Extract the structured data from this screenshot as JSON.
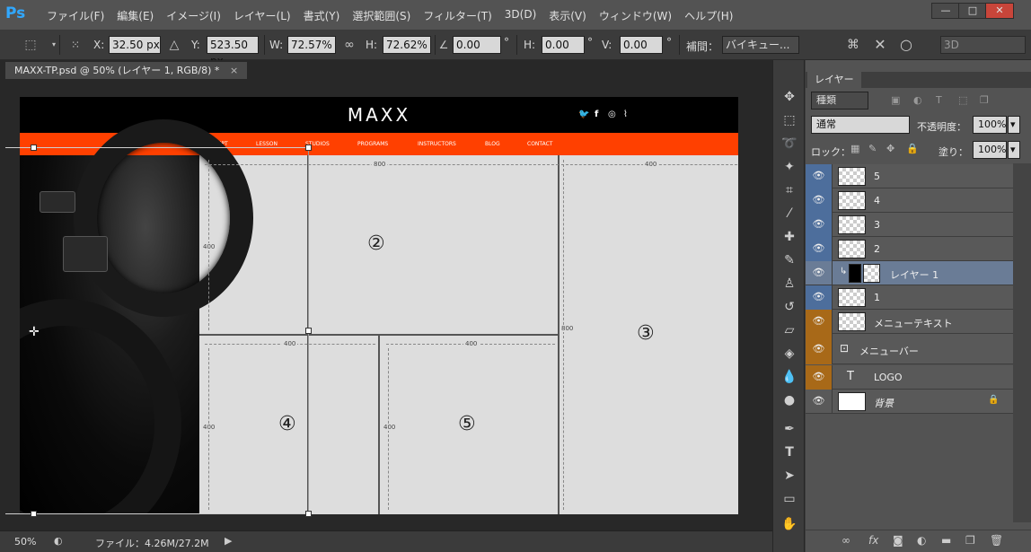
{
  "app": {
    "logo": "Ps",
    "menu": [
      "ファイル(F)",
      "編集(E)",
      "イメージ(I)",
      "レイヤー(L)",
      "書式(Y)",
      "選択範囲(S)",
      "フィルター(T)",
      "3D(D)",
      "表示(V)",
      "ウィンドウ(W)",
      "ヘルプ(H)"
    ],
    "window_buttons": [
      "—",
      "□",
      "✕"
    ]
  },
  "options": {
    "x_label": "X:",
    "x_value": "32.50 px",
    "y_label": "Y:",
    "y_value": "523.50 px",
    "w_label": "W:",
    "w_value": "72.57%",
    "h_label": "H:",
    "h_value": "72.62%",
    "angle_value": "0.00",
    "angle_unit": "°",
    "hskew_label": "H:",
    "hskew_value": "0.00",
    "hskew_unit": "°",
    "vskew_label": "V:",
    "vskew_value": "0.00",
    "vskew_unit": "°",
    "interp_label": "補間：",
    "interp_value": "バイキュー...",
    "mode_3d": "3D"
  },
  "document": {
    "tab_title": "MAXX-TP.psd @ 50% (レイヤー 1, RGB/8) *",
    "close": "×"
  },
  "mockup": {
    "logo": "MAXX",
    "social_icons": [
      "twitter-icon",
      "facebook-icon",
      "instagram-icon",
      "rss-icon"
    ],
    "nav": [
      "CONCEPT",
      "LESSON",
      "STUDIOS",
      "PROGRAMS",
      "INSTRUCTORS",
      "BLOG",
      "CONTACT"
    ],
    "dims": {
      "top_800": "800",
      "top_400": "400",
      "left_400": "400",
      "mid_800": "800",
      "row2_400a": "400",
      "row2_400b": "400",
      "left2_400": "400",
      "mid2_400": "400"
    },
    "cells": [
      "②",
      "③",
      "④",
      "⑤"
    ]
  },
  "status": {
    "zoom": "50%",
    "file": "ファイル：4.26M/27.2M"
  },
  "layers_panel": {
    "tab": "レイヤー",
    "filter": "種類",
    "blend_mode": "通常",
    "opacity_label": "不透明度：",
    "opacity_value": "100%",
    "lock_label": "ロック：",
    "fill_label": "塗り：",
    "fill_value": "100%",
    "layers": [
      {
        "name": "5",
        "color": "blue"
      },
      {
        "name": "4",
        "color": "blue"
      },
      {
        "name": "3",
        "color": "blue"
      },
      {
        "name": "2",
        "color": "blue"
      },
      {
        "name": "レイヤー 1",
        "color": "selected"
      },
      {
        "name": "1",
        "color": "blue"
      },
      {
        "name": "メニューテキスト",
        "color": "orange"
      },
      {
        "name": "メニューバー",
        "color": "orange"
      },
      {
        "name": "LOGO",
        "color": "orange"
      },
      {
        "name": "背景",
        "color": "none"
      }
    ]
  },
  "colors": {
    "nav_orange": "#ff4000",
    "layer_blue": "#4d6e9c",
    "layer_orange": "#a86918",
    "ps_blue": "#31a8ff"
  }
}
